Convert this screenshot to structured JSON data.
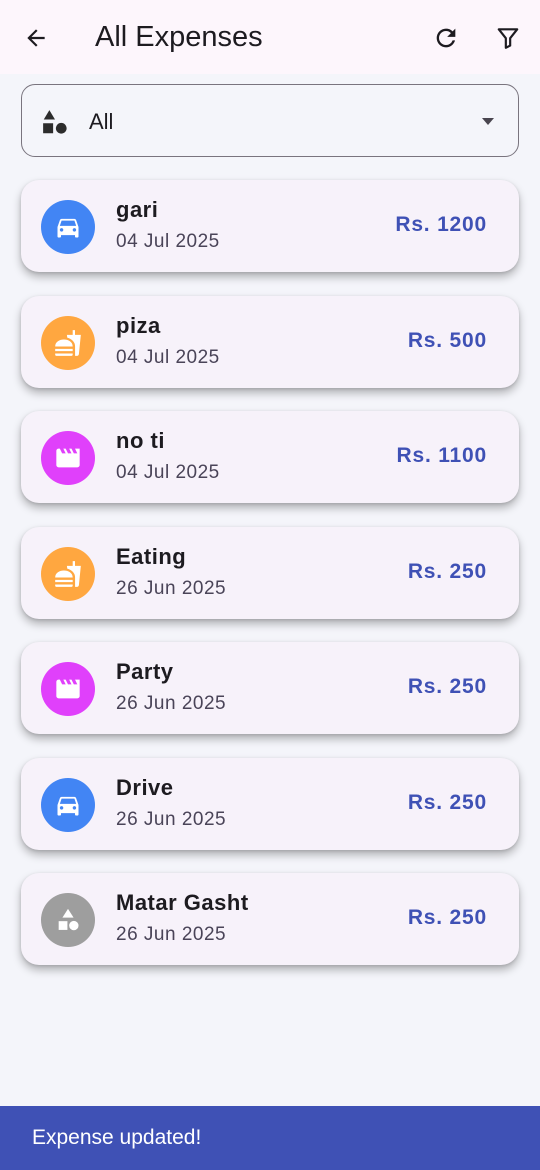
{
  "header": {
    "title": "All Expenses",
    "back_icon": "arrow-back-icon",
    "refresh_icon": "refresh-icon",
    "filter_icon": "filter-icon"
  },
  "category_filter": {
    "value": "All",
    "icon": "category-shapes-icon"
  },
  "colors": {
    "accent": "#3f51b5",
    "transport": "#4285f4",
    "food": "#ffa740",
    "entertainment": "#e040fb",
    "other": "#9e9e9e"
  },
  "expenses": [
    {
      "name": "gari",
      "date": "04 Jul 2025",
      "amount": "Rs. 1200",
      "icon": "car-icon",
      "color": "#4285f4"
    },
    {
      "name": "piza",
      "date": "04 Jul 2025",
      "amount": "Rs. 500",
      "icon": "fastfood-icon",
      "color": "#ffa740"
    },
    {
      "name": "no ti",
      "date": "04 Jul 2025",
      "amount": "Rs. 1100",
      "icon": "movie-icon",
      "color": "#e040fb"
    },
    {
      "name": "Eating",
      "date": "26 Jun 2025",
      "amount": "Rs. 250",
      "icon": "fastfood-icon",
      "color": "#ffa740"
    },
    {
      "name": "Party",
      "date": "26 Jun 2025",
      "amount": "Rs. 250",
      "icon": "movie-icon",
      "color": "#e040fb"
    },
    {
      "name": "Drive",
      "date": "26 Jun 2025",
      "amount": "Rs. 250",
      "icon": "car-icon",
      "color": "#4285f4"
    },
    {
      "name": "Matar Gasht",
      "date": "26 Jun 2025",
      "amount": "Rs. 250",
      "icon": "category-shapes-icon",
      "color": "#9e9e9e"
    }
  ],
  "snackbar": {
    "message": "Expense updated!"
  }
}
